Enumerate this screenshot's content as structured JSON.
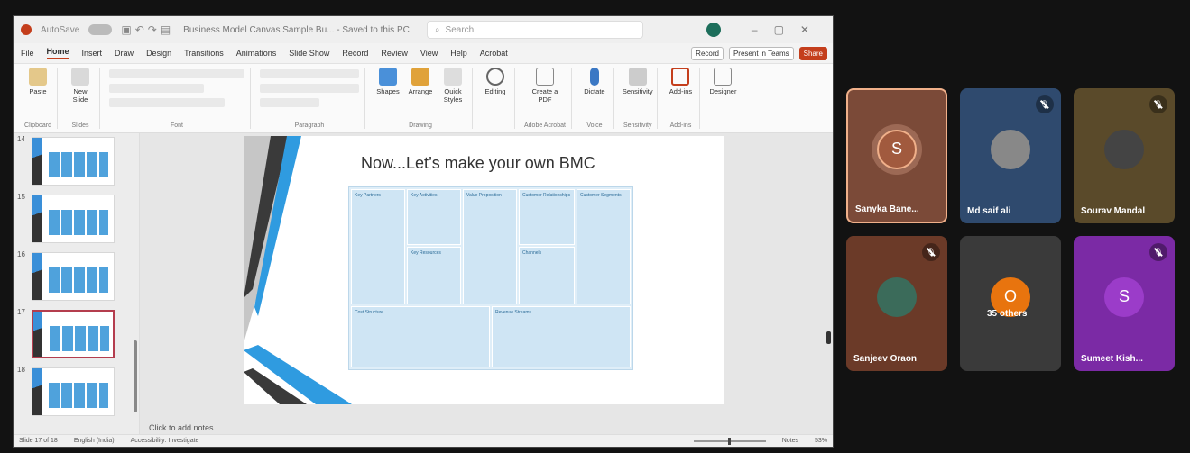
{
  "ppt": {
    "titlebar": {
      "autosave": "AutoSave",
      "autosave_state": "Off",
      "doc_title": "Business Model Canvas Sample Bu... - Saved to this PC",
      "search_placeholder": "Search"
    },
    "tabs": [
      "File",
      "Home",
      "Insert",
      "Draw",
      "Design",
      "Transitions",
      "Animations",
      "Slide Show",
      "Record",
      "Review",
      "View",
      "Help",
      "Acrobat"
    ],
    "active_tab": "Home",
    "right_buttons": {
      "record": "Record",
      "present": "Present in Teams",
      "share": "Share"
    },
    "ribbon": {
      "groups": [
        {
          "label": "Clipboard",
          "buttons": [
            "Paste"
          ]
        },
        {
          "label": "Slides",
          "buttons": [
            "New Slide"
          ]
        },
        {
          "label": "Font",
          "buttons": []
        },
        {
          "label": "Paragraph",
          "buttons": []
        },
        {
          "label": "Drawing",
          "buttons": [
            "Shapes",
            "Arrange",
            "Quick Styles"
          ]
        },
        {
          "label": "",
          "buttons": [
            "Editing"
          ]
        },
        {
          "label": "Adobe Acrobat",
          "buttons": [
            "Create a PDF"
          ]
        },
        {
          "label": "Voice",
          "buttons": [
            "Dictate"
          ]
        },
        {
          "label": "Sensitivity",
          "buttons": [
            "Sensitivity"
          ]
        },
        {
          "label": "Add-ins",
          "buttons": [
            "Add-ins"
          ]
        },
        {
          "label": "",
          "buttons": [
            "Designer"
          ]
        }
      ]
    },
    "thumbnails": [
      {
        "num": "14",
        "selected": false
      },
      {
        "num": "15",
        "selected": false
      },
      {
        "num": "16",
        "selected": false
      },
      {
        "num": "17",
        "selected": true
      },
      {
        "num": "18",
        "selected": false
      }
    ],
    "slide": {
      "title": "Now...Let’s make your own BMC",
      "cells": [
        "Key Partners",
        "Key Activities",
        "Value Proposition",
        "Customer Relationships",
        "Customer Segments",
        "Key Resources",
        "Channels",
        "Cost Structure",
        "Revenue Streams"
      ]
    },
    "notes_placeholder": "Click to add notes",
    "status": {
      "slide_of": "Slide 17 of 18",
      "language": "English (India)",
      "accessibility": "Accessibility: Investigate",
      "notes": "Notes",
      "zoom": "53%"
    }
  },
  "participants": [
    {
      "name": "Sanyka Bane...",
      "initial": "S",
      "muted": false,
      "bg": "#7b4a38",
      "avatar_bg": "#a15a3e",
      "highlight": true
    },
    {
      "name": "Md saif ali",
      "initial": "",
      "muted": true,
      "bg": "#2f4a6e",
      "avatar_bg": "#888888",
      "highlight": false
    },
    {
      "name": "Sourav Mandal",
      "initial": "",
      "muted": true,
      "bg": "#5a4a2a",
      "avatar_bg": "#444444",
      "highlight": false
    },
    {
      "name": "Sanjeev Oraon",
      "initial": "",
      "muted": true,
      "bg": "#6b3a28",
      "avatar_bg": "#3b6b5a",
      "highlight": false
    },
    {
      "name": "35 others",
      "initial": "O",
      "muted": false,
      "bg": "#3a3a3a",
      "avatar_bg": "#e8740e",
      "highlight": false
    },
    {
      "name": "Sumeet Kish...",
      "initial": "S",
      "muted": true,
      "bg": "#7b2aa5",
      "avatar_bg": "#9b3cc9",
      "highlight": false
    }
  ]
}
